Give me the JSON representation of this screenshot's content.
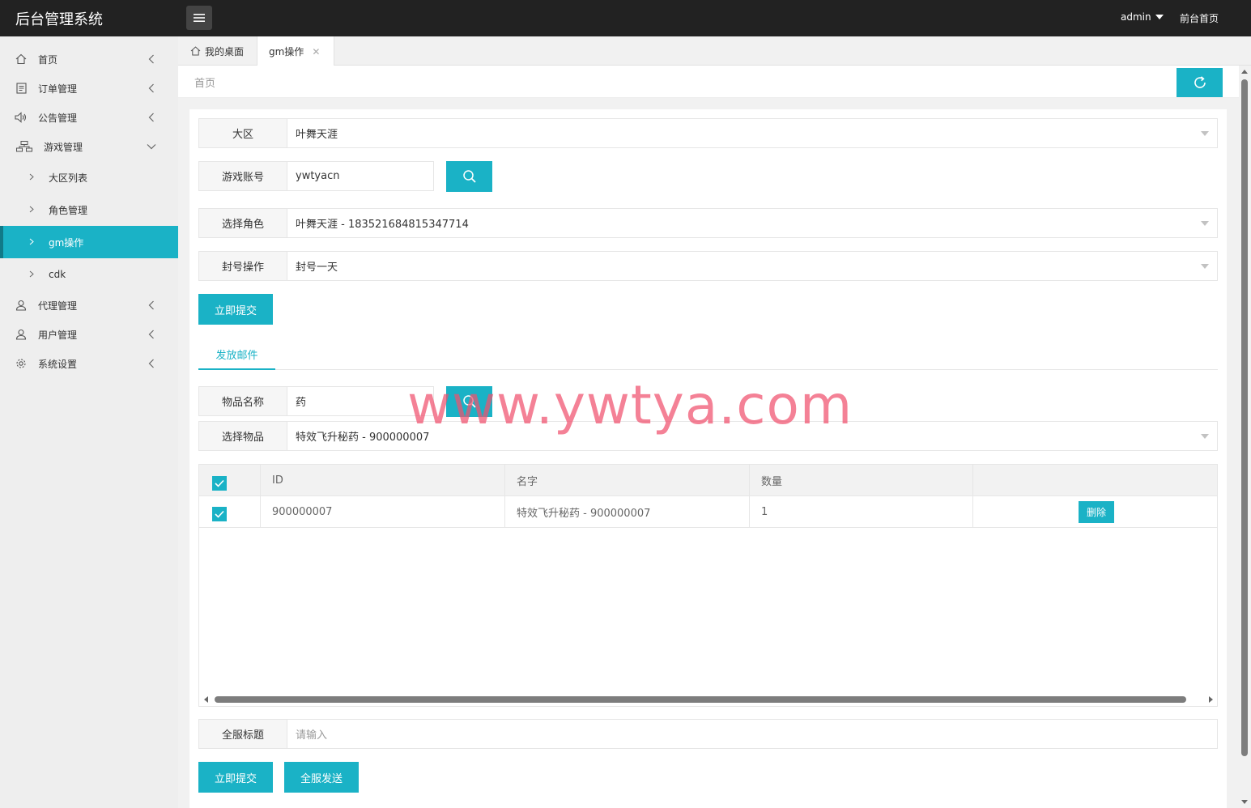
{
  "app": {
    "title": "后台管理系统"
  },
  "header": {
    "user": "admin",
    "front_link": "前台首页"
  },
  "sidebar": {
    "items": [
      {
        "label": "首页",
        "icon": "home-icon"
      },
      {
        "label": "订单管理",
        "icon": "order-icon"
      },
      {
        "label": "公告管理",
        "icon": "speaker-icon"
      },
      {
        "label": "游戏管理",
        "icon": "sitemap-icon"
      },
      {
        "label": "代理管理",
        "icon": "user-icon"
      },
      {
        "label": "用户管理",
        "icon": "user-icon"
      },
      {
        "label": "系统设置",
        "icon": "gear-icon"
      }
    ],
    "game_sub": [
      {
        "label": "大区列表"
      },
      {
        "label": "角色管理"
      },
      {
        "label": "gm操作"
      },
      {
        "label": "cdk"
      }
    ]
  },
  "tabs": [
    {
      "label": "我的桌面"
    },
    {
      "label": "gm操作"
    }
  ],
  "breadcrumb": "首页",
  "form": {
    "region_label": "大区",
    "region_value": "叶舞天涯",
    "account_label": "游戏账号",
    "account_value": "ywtyacn",
    "role_label": "选择角色",
    "role_value": "叶舞天涯 - 183521684815347714",
    "ban_label": "封号操作",
    "ban_value": "封号一天",
    "submit_label": "立即提交"
  },
  "mail": {
    "tab_label": "发放邮件",
    "item_name_label": "物品名称",
    "item_name_value": "药",
    "select_item_label": "选择物品",
    "select_item_value": "特效飞升秘药 - 900000007",
    "table": {
      "headers": [
        "ID",
        "名字",
        "数量"
      ],
      "rows": [
        {
          "id": "900000007",
          "name": "特效飞升秘药 - 900000007",
          "qty": "1",
          "action": "删除"
        }
      ]
    },
    "title_label": "全服标题",
    "title_placeholder": "请输入",
    "submit_label": "立即提交",
    "broadcast_label": "全服发送"
  },
  "watermark": "www.ywtya.com",
  "colors": {
    "accent": "#1ab2c6",
    "header_bg": "#222222",
    "sidebar_bg": "#eeeeee"
  }
}
